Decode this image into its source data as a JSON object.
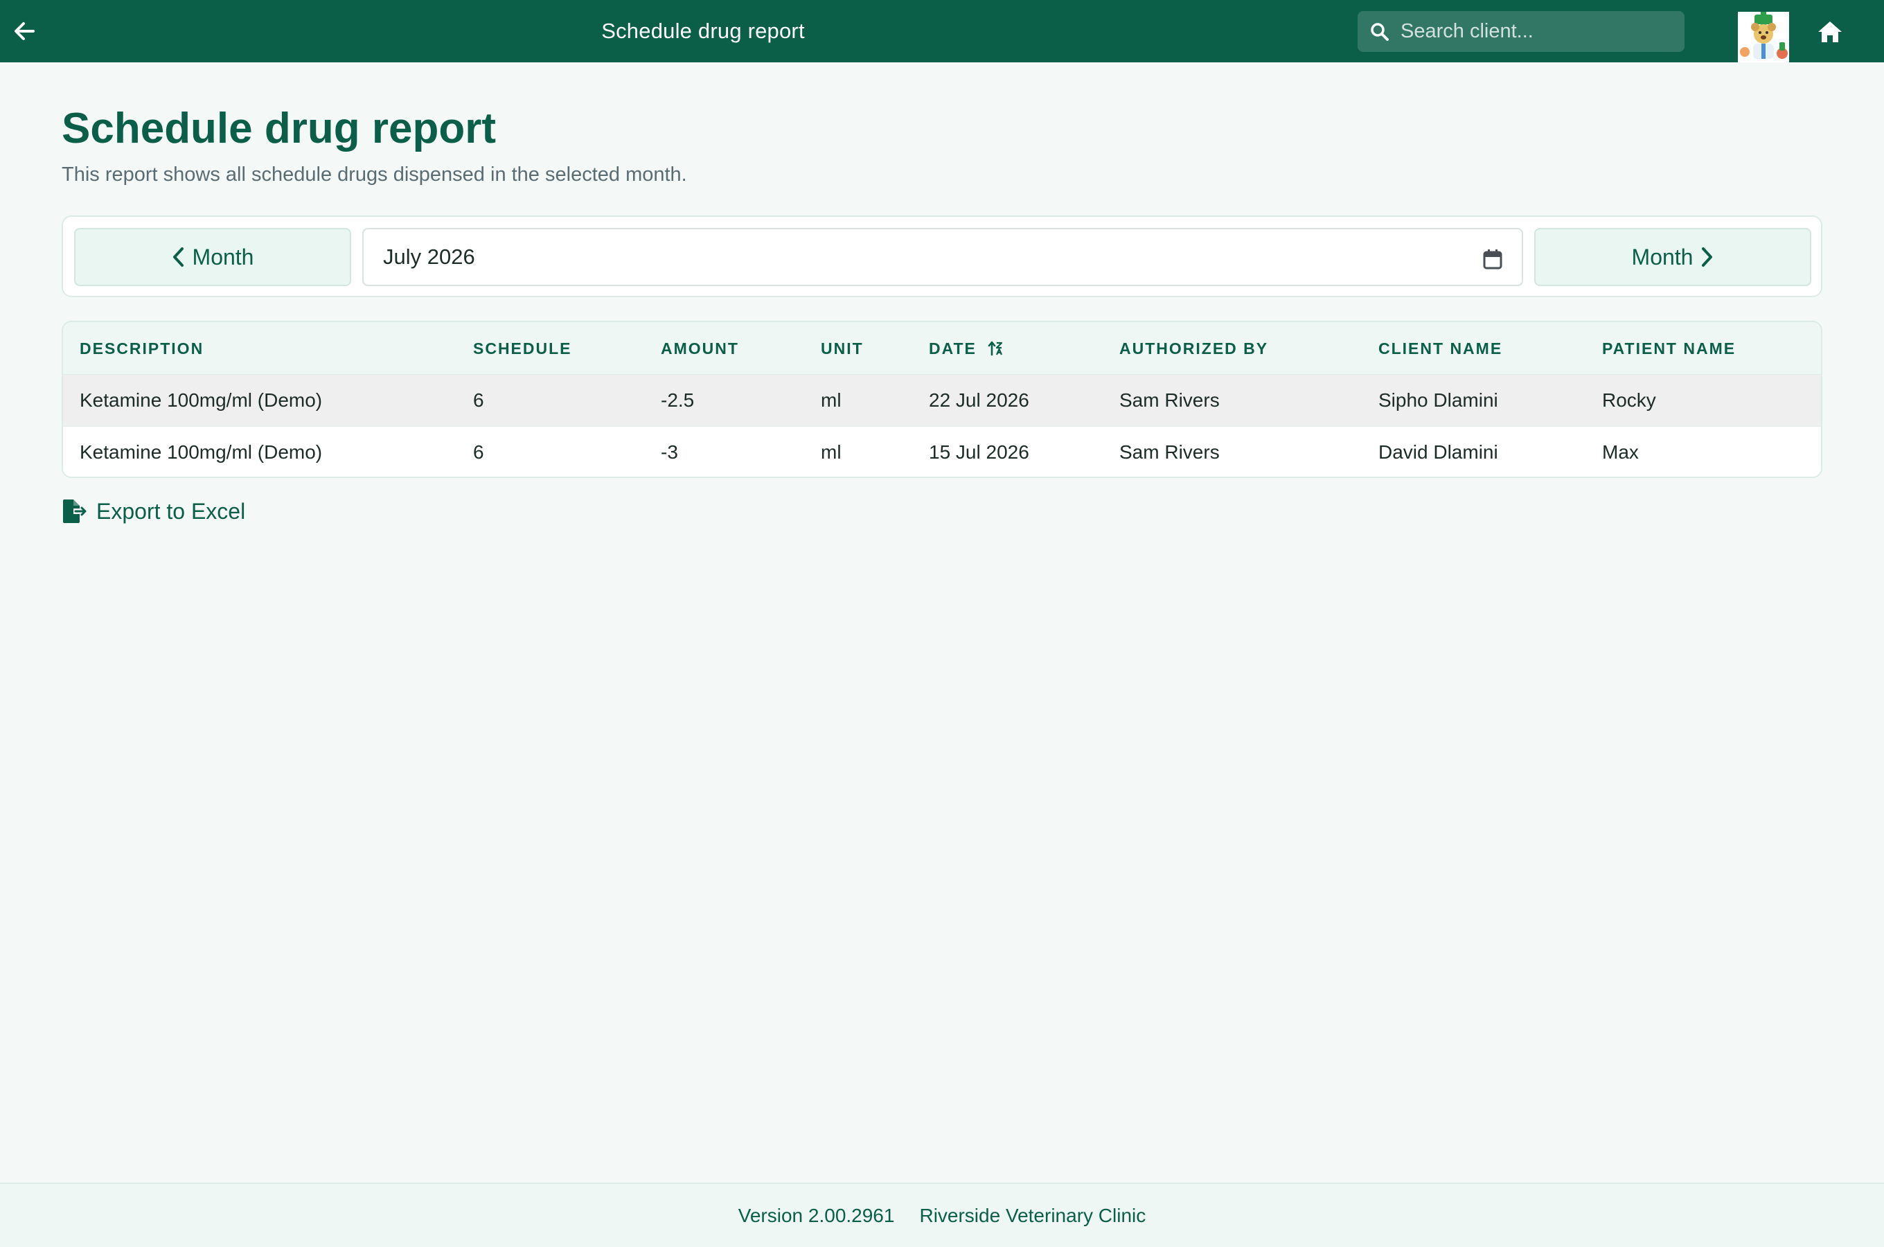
{
  "header": {
    "title": "Schedule drug report",
    "search_placeholder": "Search client...",
    "back_icon": "arrow-left-icon",
    "search_icon": "search-icon",
    "avatar": "clinic-logo",
    "home_icon": "home-icon"
  },
  "page": {
    "title": "Schedule drug report",
    "subtitle": "This report shows all schedule drugs dispensed in the selected month."
  },
  "month_selector": {
    "prev_label": "Month",
    "next_label": "Month",
    "current_month": "July 2026",
    "calendar_icon": "calendar-icon"
  },
  "table": {
    "columns": [
      "DESCRIPTION",
      "SCHEDULE",
      "AMOUNT",
      "UNIT",
      "DATE",
      "AUTHORIZED BY",
      "CLIENT NAME",
      "PATIENT NAME"
    ],
    "sorted_column": "DATE",
    "rows": [
      {
        "description": "Ketamine 100mg/ml (Demo)",
        "schedule": "6",
        "amount": "-2.5",
        "unit": "ml",
        "date": "22 Jul 2026",
        "authorized_by": "Sam Rivers",
        "client_name": "Sipho Dlamini",
        "patient_name": "Rocky"
      },
      {
        "description": "Ketamine 100mg/ml (Demo)",
        "schedule": "6",
        "amount": "-3",
        "unit": "ml",
        "date": "15 Jul 2026",
        "authorized_by": "Sam Rivers",
        "client_name": "David Dlamini",
        "patient_name": "Max"
      }
    ]
  },
  "export": {
    "label": "Export to Excel",
    "icon": "file-export-icon"
  },
  "footer": {
    "version": "Version 2.00.2961",
    "clinic": "Riverside Veterinary Clinic"
  },
  "colors": {
    "primary": "#0b5e48",
    "background": "#f4f9f8",
    "header_row": "#eef7f4",
    "striped_row": "#efefef"
  }
}
